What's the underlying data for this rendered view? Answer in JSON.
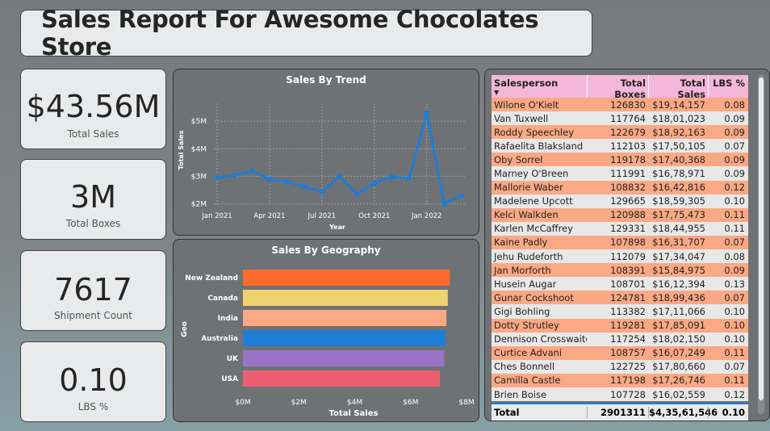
{
  "report": {
    "title": "Sales Report For Awesome Chocolates Store"
  },
  "kpis": [
    {
      "value": "$43.56M",
      "label": "Total Sales"
    },
    {
      "value": "3M",
      "label": "Total Boxes"
    },
    {
      "value": "7617",
      "label": "Shipment Count"
    },
    {
      "value": "0.10",
      "label": "LBS %"
    }
  ],
  "trend": {
    "title": "Sales By Trend",
    "xlabel": "Year",
    "ylabel": "Total Sales",
    "yticks": [
      "$2M",
      "$3M",
      "$4M",
      "$5M"
    ],
    "xticks": [
      "Jan 2021",
      "Apr 2021",
      "Jul 2021",
      "Oct 2021",
      "Jan 2022"
    ],
    "line_color": "#1f7dd6"
  },
  "geo": {
    "title": "Sales By Geography",
    "xlabel": "Total Sales",
    "ylabel": "Geo",
    "xticks": [
      "$0M",
      "$2M",
      "$4M",
      "$6M",
      "$8M"
    ]
  },
  "chart_data": [
    {
      "type": "line",
      "title": "Sales By Trend",
      "xlabel": "Year",
      "ylabel": "Total Sales",
      "ylim": [
        1.9,
        5.5
      ],
      "x": [
        "2021-01",
        "2021-02",
        "2021-03",
        "2021-04",
        "2021-05",
        "2021-06",
        "2021-07",
        "2021-08",
        "2021-09",
        "2021-10",
        "2021-11",
        "2021-12",
        "2022-01",
        "2022-02",
        "2022-03"
      ],
      "series": [
        {
          "values": [
            2.95,
            3.03,
            3.2,
            2.88,
            2.8,
            2.62,
            2.43,
            3.0,
            2.35,
            2.75,
            2.98,
            2.93,
            5.3,
            2.0,
            2.3
          ]
        }
      ]
    },
    {
      "type": "bar",
      "orientation": "horizontal",
      "title": "Sales By Geography",
      "xlabel": "Total Sales",
      "ylabel": "Geo",
      "xlim": [
        0,
        8
      ],
      "categories": [
        "New Zealand",
        "Canada",
        "India",
        "Australia",
        "UK",
        "USA"
      ],
      "values": [
        7.4,
        7.33,
        7.28,
        7.25,
        7.2,
        7.05
      ],
      "colors": [
        "#fd6b2c",
        "#eed270",
        "#fba884",
        "#1f7dd6",
        "#9873c6",
        "#ed5f70"
      ]
    },
    {
      "type": "table",
      "columns": [
        "Salesperson",
        "Total Boxes",
        "Total Sales",
        "LBS %"
      ],
      "rows": [
        [
          "Wilone O'Kielt",
          "126830",
          "$19,14,157",
          "0.08"
        ],
        [
          "Van Tuxwell",
          "117764",
          "$18,01,023",
          "0.09"
        ],
        [
          "Roddy Speechley",
          "122679",
          "$18,92,163",
          "0.09"
        ],
        [
          "Rafaelita Blaksland",
          "112103",
          "$17,50,105",
          "0.07"
        ],
        [
          "Oby Sorrel",
          "119178",
          "$17,40,368",
          "0.09"
        ],
        [
          "Marney O'Breen",
          "111991",
          "$16,78,971",
          "0.09"
        ],
        [
          "Mallorie Waber",
          "108832",
          "$16,42,816",
          "0.12"
        ],
        [
          "Madelene Upcott",
          "129665",
          "$18,59,305",
          "0.10"
        ],
        [
          "Kelci Walkden",
          "120988",
          "$17,75,473",
          "0.11"
        ],
        [
          "Karlen McCaffrey",
          "129331",
          "$18,44,955",
          "0.11"
        ],
        [
          "Kaine Padly",
          "107898",
          "$16,31,707",
          "0.07"
        ],
        [
          "Jehu Rudeforth",
          "112079",
          "$17,34,047",
          "0.08"
        ],
        [
          "Jan Morforth",
          "108391",
          "$15,84,975",
          "0.09"
        ],
        [
          "Husein Augar",
          "108701",
          "$16,12,394",
          "0.13"
        ],
        [
          "Gunar Cockshoot",
          "124781",
          "$18,99,436",
          "0.07"
        ],
        [
          "Gigi Bohling",
          "113382",
          "$17,11,066",
          "0.10"
        ],
        [
          "Dotty Strutley",
          "119281",
          "$17,85,091",
          "0.10"
        ],
        [
          "Dennison Crosswaite",
          "117254",
          "$18,02,150",
          "0.10"
        ],
        [
          "Curtice Advani",
          "108757",
          "$16,07,249",
          "0.11"
        ],
        [
          "Ches Bonnell",
          "122725",
          "$17,80,660",
          "0.07"
        ],
        [
          "Camilla Castle",
          "117198",
          "$17,26,746",
          "0.11"
        ],
        [
          "Brien Boise",
          "107728",
          "$16,02,559",
          "0.12"
        ]
      ],
      "total": [
        "Total",
        "2901311",
        "$4,35,61,546",
        "0.10"
      ]
    }
  ]
}
